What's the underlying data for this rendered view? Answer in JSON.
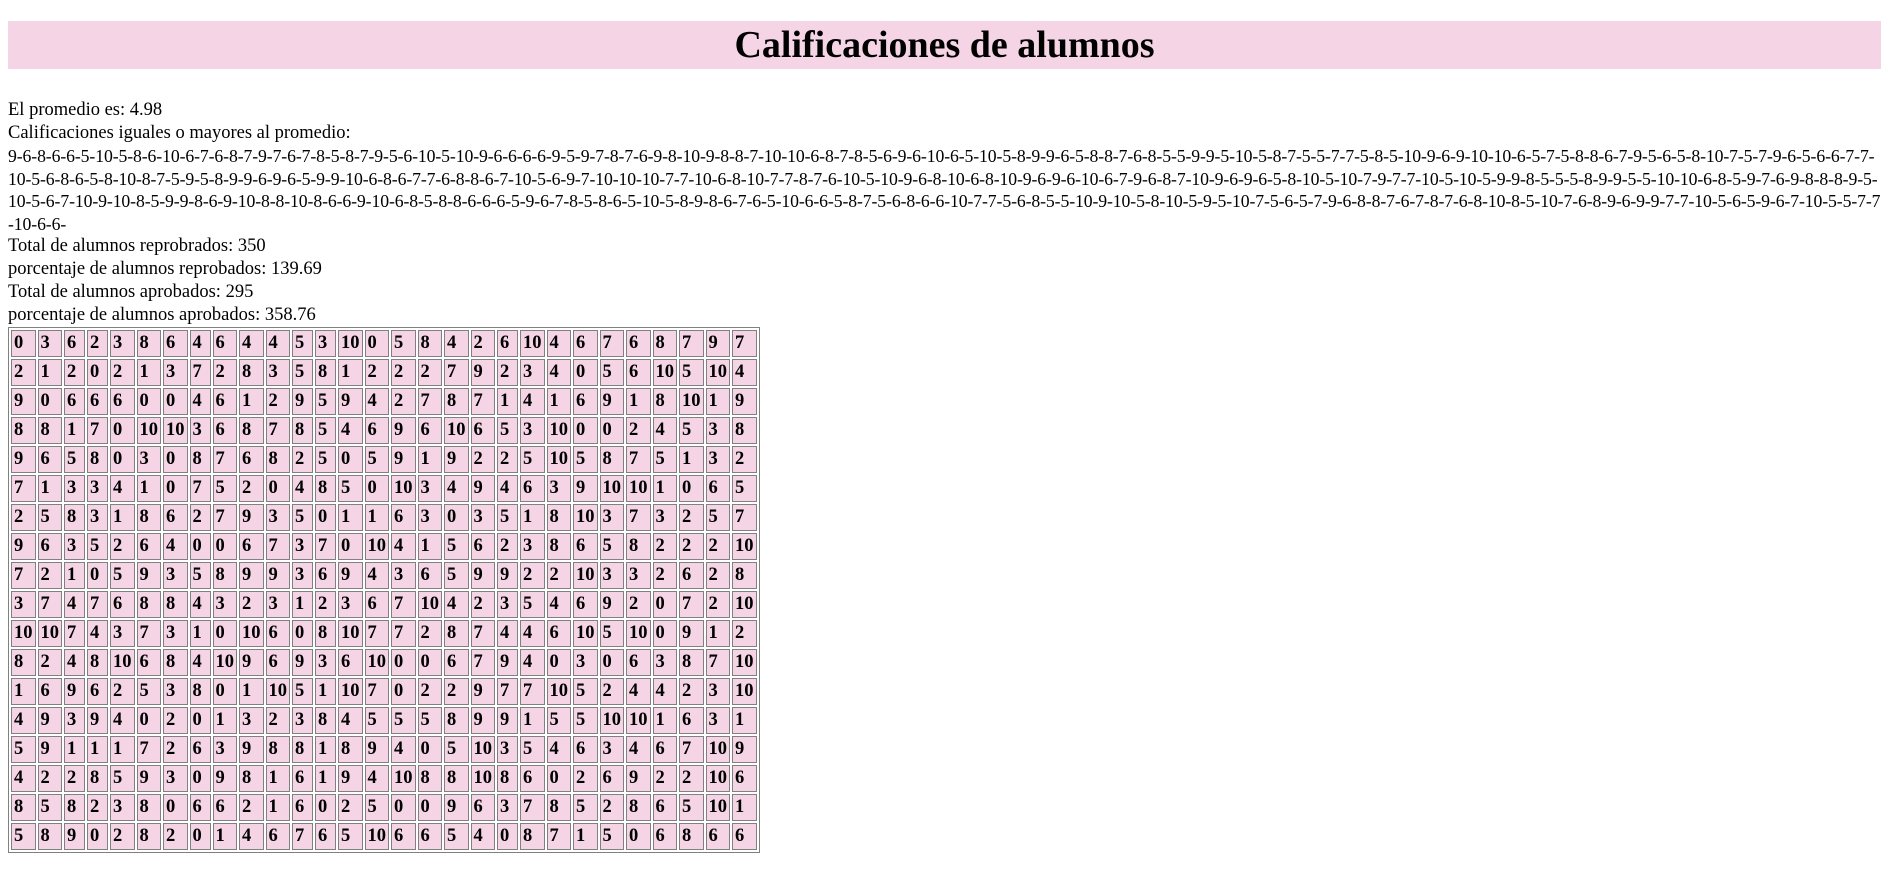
{
  "page": {
    "title": "Calificaciones de alumnos",
    "promedio_label": "El promedio es: 4.98",
    "mayores_label": "Calificaciones iguales o mayores al promedio:",
    "mayores_list": "9-6-8-6-6-5-10-5-8-6-10-6-7-6-8-7-9-7-6-7-8-5-8-7-9-5-6-10-5-10-9-6-6-6-6-9-5-9-7-8-7-6-9-8-10-9-8-8-7-10-10-6-8-7-8-5-6-9-6-10-6-5-10-5-8-9-9-6-5-8-8-7-6-8-5-5-9-9-5-10-5-8-7-5-5-7-7-5-8-5-10-9-6-9-10-10-6-5-7-5-8-8-6-7-9-5-6-5-8-10-7-5-7-9-6-5-6-6-7-7-10-5-6-8-6-5-8-10-8-7-5-9-5-8-9-9-6-9-6-5-9-9-10-6-8-6-7-7-6-8-8-6-7-10-5-6-9-7-10-10-10-7-7-10-6-8-10-7-7-8-7-6-10-5-10-9-6-8-10-6-8-10-9-6-9-6-10-6-7-9-6-8-7-10-9-6-9-6-5-8-10-5-10-7-9-7-7-10-5-10-5-9-9-8-5-5-5-8-9-9-5-5-10-10-6-8-5-9-7-6-9-8-8-8-9-5-10-5-6-7-10-9-10-8-5-9-9-8-6-9-10-8-8-10-8-6-6-9-10-6-8-5-8-8-6-6-6-5-9-6-7-8-5-8-6-5-10-5-8-9-8-6-7-6-5-10-6-6-5-8-7-5-6-8-6-6-10-7-7-5-6-8-5-5-10-9-10-5-8-10-5-9-5-10-7-5-6-5-7-9-6-8-8-7-6-7-8-7-6-8-10-8-5-10-7-6-8-9-6-9-9-7-7-10-5-6-5-9-6-7-10-5-5-7-7-10-6-6-",
    "reprobados_total": "Total de alumnos reprobrados: 350",
    "reprobados_pct": "porcentaje de alumnos reprobados: 139.69",
    "aprobados_total": "Total de alumnos aprobados: 295",
    "aprobados_pct": "porcentaje de alumnos aprobados: 358.76"
  },
  "grid": [
    [
      "0",
      "3",
      "6",
      "2",
      "3",
      "8",
      "6",
      "4",
      "6",
      "4",
      "4",
      "5",
      "3",
      "10",
      "0",
      "5",
      "8",
      "4",
      "2",
      "6",
      "10",
      "4",
      "6",
      "7",
      "6",
      "8",
      "7",
      "9",
      "7"
    ],
    [
      "2",
      "1",
      "2",
      "0",
      "2",
      "1",
      "3",
      "7",
      "2",
      "8",
      "3",
      "5",
      "8",
      "1",
      "2",
      "2",
      "2",
      "7",
      "9",
      "2",
      "3",
      "4",
      "0",
      "5",
      "6",
      "10",
      "5",
      "10",
      "4"
    ],
    [
      "9",
      "0",
      "6",
      "6",
      "6",
      "0",
      "0",
      "4",
      "6",
      "1",
      "2",
      "9",
      "5",
      "9",
      "4",
      "2",
      "7",
      "8",
      "7",
      "1",
      "4",
      "1",
      "6",
      "9",
      "1",
      "8",
      "10",
      "1",
      "9"
    ],
    [
      "8",
      "8",
      "1",
      "7",
      "0",
      "10",
      "10",
      "3",
      "6",
      "8",
      "7",
      "8",
      "5",
      "4",
      "6",
      "9",
      "6",
      "10",
      "6",
      "5",
      "3",
      "10",
      "0",
      "0",
      "2",
      "4",
      "5",
      "3",
      "8"
    ],
    [
      "9",
      "6",
      "5",
      "8",
      "0",
      "3",
      "0",
      "8",
      "7",
      "6",
      "8",
      "2",
      "5",
      "0",
      "5",
      "9",
      "1",
      "9",
      "2",
      "2",
      "5",
      "10",
      "5",
      "8",
      "7",
      "5",
      "1",
      "3",
      "2"
    ],
    [
      "7",
      "1",
      "3",
      "3",
      "4",
      "1",
      "0",
      "7",
      "5",
      "2",
      "0",
      "4",
      "8",
      "5",
      "0",
      "10",
      "3",
      "4",
      "9",
      "4",
      "6",
      "3",
      "9",
      "10",
      "10",
      "1",
      "0",
      "6",
      "5"
    ],
    [
      "2",
      "5",
      "8",
      "3",
      "1",
      "8",
      "6",
      "2",
      "7",
      "9",
      "3",
      "5",
      "0",
      "1",
      "1",
      "6",
      "3",
      "0",
      "3",
      "5",
      "1",
      "8",
      "10",
      "3",
      "7",
      "3",
      "2",
      "5",
      "7"
    ],
    [
      "9",
      "6",
      "3",
      "5",
      "2",
      "6",
      "4",
      "0",
      "0",
      "6",
      "7",
      "3",
      "7",
      "0",
      "10",
      "4",
      "1",
      "5",
      "6",
      "2",
      "3",
      "8",
      "6",
      "5",
      "8",
      "2",
      "2",
      "2",
      "10"
    ],
    [
      "7",
      "2",
      "1",
      "0",
      "5",
      "9",
      "3",
      "5",
      "8",
      "9",
      "9",
      "3",
      "6",
      "9",
      "4",
      "3",
      "6",
      "5",
      "9",
      "9",
      "2",
      "2",
      "10",
      "3",
      "3",
      "2",
      "6",
      "2",
      "8"
    ],
    [
      "3",
      "7",
      "4",
      "7",
      "6",
      "8",
      "8",
      "4",
      "3",
      "2",
      "3",
      "1",
      "2",
      "3",
      "6",
      "7",
      "10",
      "4",
      "2",
      "3",
      "5",
      "4",
      "6",
      "9",
      "2",
      "0",
      "7",
      "2",
      "10"
    ],
    [
      "10",
      "10",
      "7",
      "4",
      "3",
      "7",
      "3",
      "1",
      "0",
      "10",
      "6",
      "0",
      "8",
      "10",
      "7",
      "7",
      "2",
      "8",
      "7",
      "4",
      "4",
      "6",
      "10",
      "5",
      "10",
      "0",
      "9",
      "1",
      "2"
    ],
    [
      "8",
      "2",
      "4",
      "8",
      "10",
      "6",
      "8",
      "4",
      "10",
      "9",
      "6",
      "9",
      "3",
      "6",
      "10",
      "0",
      "0",
      "6",
      "7",
      "9",
      "4",
      "0",
      "3",
      "0",
      "6",
      "3",
      "8",
      "7",
      "10"
    ],
    [
      "1",
      "6",
      "9",
      "6",
      "2",
      "5",
      "3",
      "8",
      "0",
      "1",
      "10",
      "5",
      "1",
      "10",
      "7",
      "0",
      "2",
      "2",
      "9",
      "7",
      "7",
      "10",
      "5",
      "2",
      "4",
      "4",
      "2",
      "3",
      "10"
    ],
    [
      "4",
      "9",
      "3",
      "9",
      "4",
      "0",
      "2",
      "0",
      "1",
      "3",
      "2",
      "3",
      "8",
      "4",
      "5",
      "5",
      "5",
      "8",
      "9",
      "9",
      "1",
      "5",
      "5",
      "10",
      "10",
      "1",
      "6",
      "3",
      "1"
    ],
    [
      "5",
      "9",
      "1",
      "1",
      "1",
      "7",
      "2",
      "6",
      "3",
      "9",
      "8",
      "8",
      "1",
      "8",
      "9",
      "4",
      "0",
      "5",
      "10",
      "3",
      "5",
      "4",
      "6",
      "3",
      "4",
      "6",
      "7",
      "10",
      "9"
    ],
    [
      "4",
      "2",
      "2",
      "8",
      "5",
      "9",
      "3",
      "0",
      "9",
      "8",
      "1",
      "6",
      "1",
      "9",
      "4",
      "10",
      "8",
      "8",
      "10",
      "8",
      "6",
      "0",
      "2",
      "6",
      "9",
      "2",
      "2",
      "10",
      "6"
    ],
    [
      "8",
      "5",
      "8",
      "2",
      "3",
      "8",
      "0",
      "6",
      "6",
      "2",
      "1",
      "6",
      "0",
      "2",
      "5",
      "0",
      "0",
      "9",
      "6",
      "3",
      "7",
      "8",
      "5",
      "2",
      "8",
      "6",
      "5",
      "10",
      "1"
    ],
    [
      "5",
      "8",
      "9",
      "0",
      "2",
      "8",
      "2",
      "0",
      "1",
      "4",
      "6",
      "7",
      "6",
      "5",
      "10",
      "6",
      "6",
      "5",
      "4",
      "0",
      "8",
      "7",
      "1",
      "5",
      "0",
      "6",
      "8",
      "6",
      "6"
    ]
  ]
}
